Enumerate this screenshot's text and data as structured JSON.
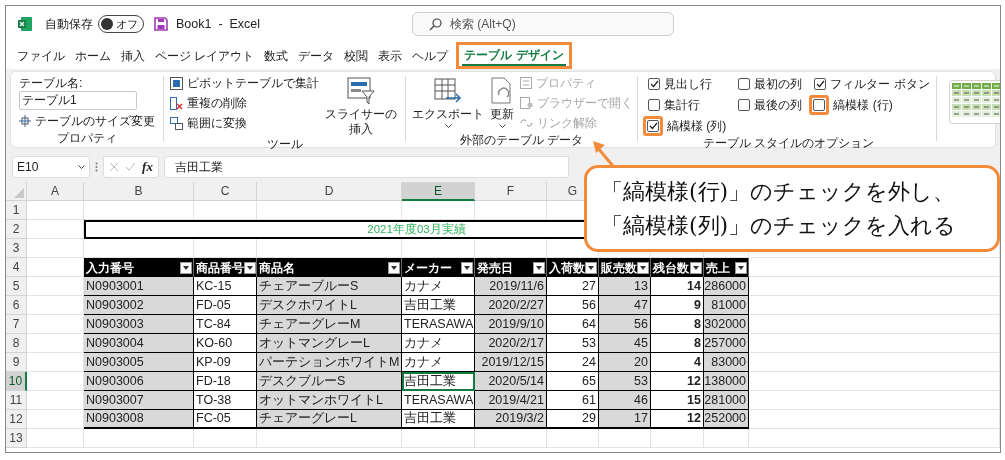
{
  "title_bar": {
    "autosave": {
      "label": "自動保存",
      "state_label": "オフ",
      "on": false
    },
    "title": "Book1  -  Excel",
    "search": {
      "placeholder": "検索 (Alt+Q)"
    }
  },
  "ribbon_tabs": [
    {
      "label": "ファイル",
      "selected": false,
      "highlighted": false
    },
    {
      "label": "ホーム",
      "selected": false,
      "highlighted": false
    },
    {
      "label": "挿入",
      "selected": false,
      "highlighted": false
    },
    {
      "label": "ページ レイアウト",
      "selected": false,
      "highlighted": false
    },
    {
      "label": "数式",
      "selected": false,
      "highlighted": false
    },
    {
      "label": "データ",
      "selected": false,
      "highlighted": false
    },
    {
      "label": "校閲",
      "selected": false,
      "highlighted": false
    },
    {
      "label": "表示",
      "selected": false,
      "highlighted": false
    },
    {
      "label": "ヘルプ",
      "selected": false,
      "highlighted": false
    },
    {
      "label": "テーブル デザイン",
      "selected": true,
      "highlighted": true
    }
  ],
  "ribbon_groups": [
    {
      "kind": "properties",
      "label": "プロパティ",
      "field_label": "テーブル名:",
      "field_value": "テーブル1",
      "items": [
        {
          "label": "テーブルのサイズ変更",
          "disabled": false
        }
      ]
    },
    {
      "kind": "tools",
      "label": "ツール",
      "items": [
        {
          "label": "ピボットテーブルで集計",
          "disabled": false
        },
        {
          "label": "重複の削除",
          "disabled": false
        },
        {
          "label": "範囲に変換",
          "disabled": false
        }
      ],
      "large_buttons": [
        {
          "label": "スライサーの挿入",
          "dropdown": false
        }
      ]
    },
    {
      "kind": "external",
      "label": "外部のテーブル データ",
      "large_buttons": [
        {
          "label": "エクスポート",
          "dropdown": true
        },
        {
          "label": "更新",
          "dropdown": true
        }
      ],
      "items": [
        {
          "label": "プロパティ",
          "disabled": true
        },
        {
          "label": "ブラウザーで開く",
          "disabled": true
        },
        {
          "label": "リンク解除",
          "disabled": true
        }
      ]
    },
    {
      "kind": "style_options",
      "label": "テーブル スタイルのオプション",
      "options": [
        {
          "label": "見出し行",
          "checked": true,
          "highlighted": false
        },
        {
          "label": "最初の列",
          "checked": false,
          "highlighted": false
        },
        {
          "label": "フィルター ボタン",
          "checked": true,
          "highlighted": false
        },
        {
          "label": "集計行",
          "checked": false,
          "highlighted": false
        },
        {
          "label": "最後の列",
          "checked": false,
          "highlighted": false
        },
        {
          "label": "縞模様 (行)",
          "checked": false,
          "highlighted": true
        },
        {
          "label": "縞模様 (列)",
          "checked": true,
          "highlighted": true
        }
      ]
    },
    {
      "kind": "styles"
    }
  ],
  "formula_bar": {
    "name_box": "E10",
    "function_label": "fx",
    "content": "吉田工業"
  },
  "sheet": {
    "columns": [
      {
        "label": "A",
        "selected": false
      },
      {
        "label": "B",
        "selected": false
      },
      {
        "label": "C",
        "selected": false
      },
      {
        "label": "D",
        "selected": false
      },
      {
        "label": "E",
        "selected": true
      },
      {
        "label": "F",
        "selected": false
      },
      {
        "label": "G",
        "selected": false
      }
    ],
    "rows": [
      {
        "label": "1",
        "selected": false
      },
      {
        "label": "2",
        "selected": false
      },
      {
        "label": "3",
        "selected": false
      },
      {
        "label": "4",
        "selected": false
      },
      {
        "label": "5",
        "selected": false
      },
      {
        "label": "6",
        "selected": false
      },
      {
        "label": "7",
        "selected": false
      },
      {
        "label": "8",
        "selected": false
      },
      {
        "label": "9",
        "selected": false
      },
      {
        "label": "10",
        "selected": true
      },
      {
        "label": "11",
        "selected": false
      },
      {
        "label": "12",
        "selected": false
      },
      {
        "label": "13",
        "selected": false
      }
    ],
    "title": "2021年度03月実績",
    "table": {
      "columns": [
        {
          "label": "入力番号",
          "kind": "text",
          "bold": false
        },
        {
          "label": "商品番号",
          "kind": "text",
          "bold": false
        },
        {
          "label": "商品名",
          "kind": "text",
          "bold": false
        },
        {
          "label": "メーカー",
          "kind": "text",
          "bold": false
        },
        {
          "label": "発売日",
          "kind": "number",
          "bold": false
        },
        {
          "label": "入荷数",
          "kind": "number",
          "bold": false
        },
        {
          "label": "販売数",
          "kind": "number",
          "bold": false
        },
        {
          "label": "残台数",
          "kind": "number",
          "bold": true
        },
        {
          "label": "売上",
          "kind": "number",
          "bold": false
        }
      ],
      "rows": [
        {
          "cells": [
            "N0903001",
            "KC-15",
            "チェアーブルーS",
            "カナメ",
            "2019/11/6",
            "27",
            "13",
            "14",
            "286000"
          ]
        },
        {
          "cells": [
            "N0903002",
            "FD-05",
            "デスクホワイトL",
            "吉田工業",
            "2020/2/27",
            "56",
            "47",
            "9",
            "81000"
          ]
        },
        {
          "cells": [
            "N0903003",
            "TC-84",
            "チェアーグレーM",
            "TERASAWA",
            "2019/9/10",
            "64",
            "56",
            "8",
            "302000"
          ]
        },
        {
          "cells": [
            "N0903004",
            "KO-60",
            "オットマングレーL",
            "カナメ",
            "2020/2/17",
            "53",
            "45",
            "8",
            "257000"
          ]
        },
        {
          "cells": [
            "N0903005",
            "KP-09",
            "パーテションホワイトM",
            "カナメ",
            "2019/12/15",
            "24",
            "20",
            "4",
            "83000"
          ]
        },
        {
          "cells": [
            "N0903006",
            "FD-18",
            "デスクブルーS",
            "吉田工業",
            "2020/5/14",
            "65",
            "53",
            "12",
            "138000"
          ]
        },
        {
          "cells": [
            "N0903007",
            "TO-38",
            "オットマンホワイトL",
            "TERASAWA",
            "2019/4/21",
            "61",
            "46",
            "15",
            "281000"
          ]
        },
        {
          "cells": [
            "N0903008",
            "FC-05",
            "チェアーグレーL",
            "吉田工業",
            "2019/3/2",
            "29",
            "17",
            "12",
            "252000"
          ]
        }
      ]
    }
  },
  "callout": {
    "lines": [
      "「縞模様(行)」のチェックを外し、",
      "「縞模様(列)」のチェックを入れる"
    ]
  }
}
